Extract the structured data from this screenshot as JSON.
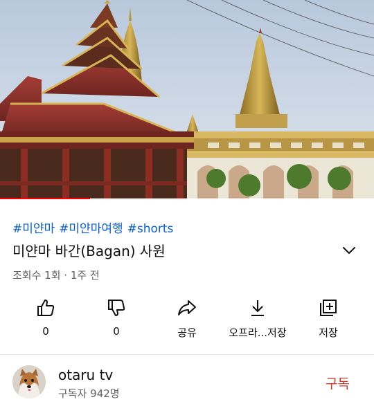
{
  "video": {
    "progress_fraction": 0.24,
    "accent_color": "#ff0000"
  },
  "hashtags": [
    "#미얀마",
    "#미얀마여행",
    "#shorts"
  ],
  "title": "미얀마 바간(Bagan) 사원",
  "meta": "조회수 1회 · 1주 전",
  "actions": [
    {
      "icon": "thumbs-up-icon",
      "label": "0"
    },
    {
      "icon": "thumbs-down-icon",
      "label": "0"
    },
    {
      "icon": "share-icon",
      "label": "공유"
    },
    {
      "icon": "download-icon",
      "label": "오프라...저장"
    },
    {
      "icon": "save-to-playlist-icon",
      "label": "저장"
    }
  ],
  "channel": {
    "name": "otaru tv",
    "subscribers": "구독자 942명",
    "subscribe_label": "구독",
    "subscribe_color": "#cc3a2a"
  }
}
